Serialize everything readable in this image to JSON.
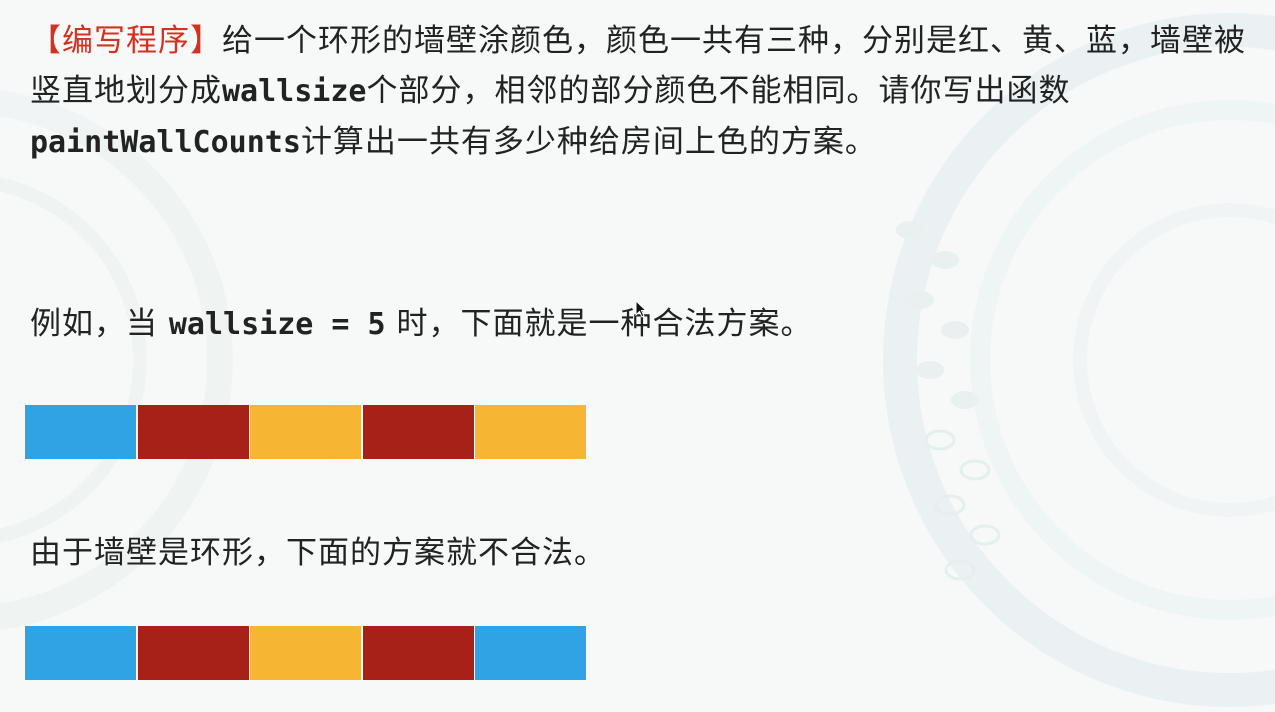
{
  "problem": {
    "tag": "【编写程序】",
    "line1_rest": "给一个环形的墙壁涂颜色，颜色一共有三种，分别是红、黄、蓝，墙壁被竖直地划分成",
    "var_wallsize": "wallsize",
    "line1_mid": "个部分，相邻的部分颜色不能相同。请你写出函数",
    "func_name": "paintWallCounts",
    "line1_end": "计算出一共有多少种给房间上色的方案。"
  },
  "example": {
    "prefix": "例如，当",
    "expr": "wallsize = 5",
    "suffix": "时，下面就是一种合法方案。"
  },
  "invalid_note": "由于墙壁是环形，下面的方案就不合法。",
  "colors": {
    "blue": "#2fa3e4",
    "red": "#a82118",
    "yellow": "#f6b634"
  },
  "valid_scheme": [
    "blue",
    "red",
    "yellow",
    "red",
    "yellow"
  ],
  "invalid_scheme": [
    "blue",
    "red",
    "yellow",
    "red",
    "blue"
  ]
}
